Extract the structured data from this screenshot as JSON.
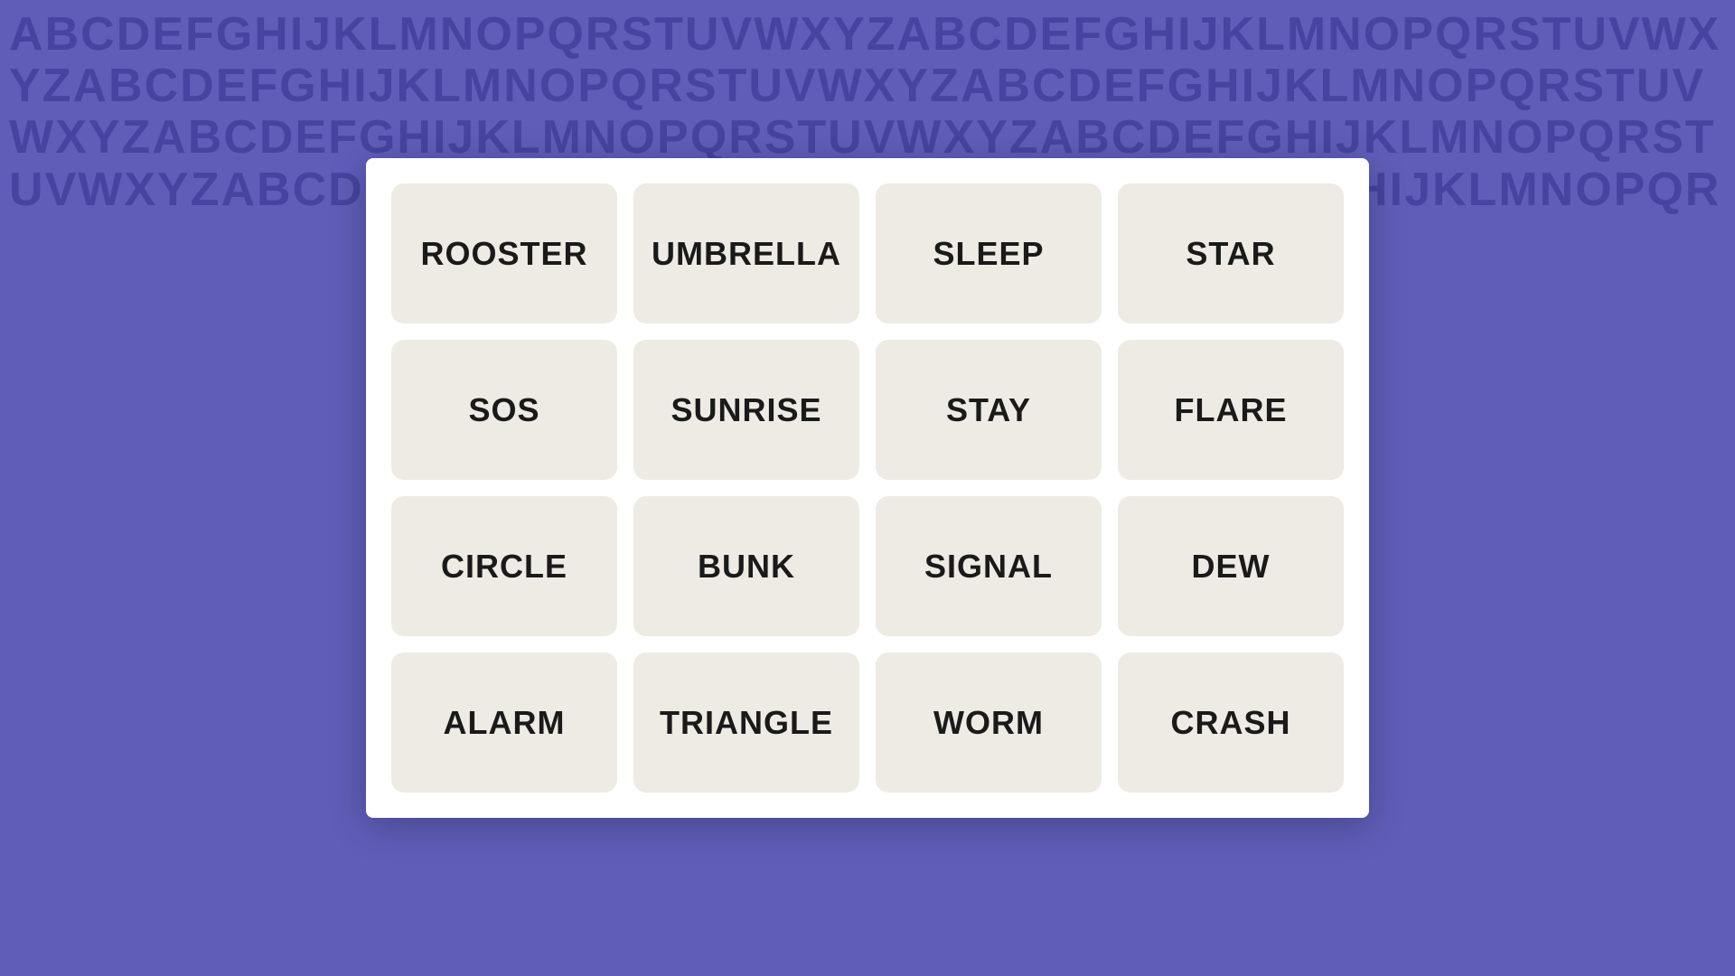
{
  "background": {
    "alphabet_text": "ABCDEFGHIJKLMNOPQRSTUVWXYZ",
    "color": "#5f5db8"
  },
  "grid": {
    "rows": [
      [
        {
          "label": "ROOSTER"
        },
        {
          "label": "UMBRELLA"
        },
        {
          "label": "SLEEP"
        },
        {
          "label": "STAR"
        }
      ],
      [
        {
          "label": "SOS"
        },
        {
          "label": "SUNRISE"
        },
        {
          "label": "STAY"
        },
        {
          "label": "FLARE"
        }
      ],
      [
        {
          "label": "CIRCLE"
        },
        {
          "label": "BUNK"
        },
        {
          "label": "SIGNAL"
        },
        {
          "label": "DEW"
        }
      ],
      [
        {
          "label": "ALARM"
        },
        {
          "label": "TRIANGLE"
        },
        {
          "label": "WORM"
        },
        {
          "label": "CRASH"
        }
      ]
    ]
  }
}
